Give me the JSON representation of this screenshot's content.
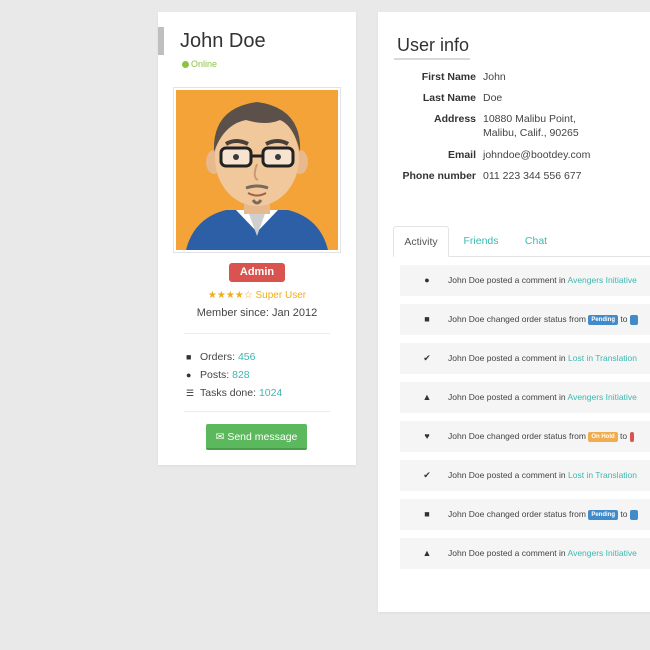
{
  "profile": {
    "name": "John Doe",
    "status": "Online",
    "badge": "Admin",
    "stars": "★★★★☆",
    "rank": "Super User",
    "member_since": "Member since: Jan 2012",
    "stats": [
      {
        "label": "Orders:",
        "value": "456",
        "icon": "truck-icon",
        "glyph": "🚚"
      },
      {
        "label": "Posts:",
        "value": "828",
        "icon": "comment-icon",
        "glyph": "💬"
      },
      {
        "label": "Tasks done:",
        "value": "1024",
        "icon": "tasks-icon",
        "glyph": "☰"
      }
    ],
    "send_button": "Send message",
    "send_icon": "✉"
  },
  "info": {
    "title": "User info",
    "rows": [
      {
        "label": "First Name",
        "value": "John"
      },
      {
        "label": "Last Name",
        "value": "Doe"
      },
      {
        "label": "Address",
        "value": "10880 Malibu Point,",
        "value2": "Malibu, Calif., 90265"
      },
      {
        "label": "Email",
        "value": "johndoe@bootdey.com"
      },
      {
        "label": "Phone number",
        "value": "011 223 344 556 677"
      }
    ]
  },
  "tabs": [
    "Activity",
    "Friends",
    "Chat"
  ],
  "activity": [
    {
      "icon": "comment-icon",
      "glyph": "💬",
      "pre": "John Doe posted a comment in ",
      "link": "Avengers Initiative",
      "kind": "link"
    },
    {
      "icon": "truck-icon",
      "glyph": "🚚",
      "pre": "John Doe changed order status from ",
      "badge": "Pending",
      "badge_class": "st-pending",
      "post": " to ",
      "kind": "status"
    },
    {
      "icon": "check-icon",
      "glyph": "✔",
      "pre": "John Doe posted a comment in ",
      "link": "Lost in Translation",
      "kind": "link"
    },
    {
      "icon": "users-icon",
      "glyph": "👥",
      "pre": "John Doe posted a comment in ",
      "link": "Avengers Initiative",
      "kind": "link"
    },
    {
      "icon": "heart-icon",
      "glyph": "♥",
      "pre": "John Doe changed order status from ",
      "badge": "On Hold",
      "badge_class": "st-hold",
      "post": " to ",
      "kind": "status"
    },
    {
      "icon": "check-icon",
      "glyph": "✔",
      "pre": "John Doe posted a comment in ",
      "link": "Lost in Translation",
      "kind": "link"
    },
    {
      "icon": "truck-icon",
      "glyph": "🚚",
      "pre": "John Doe changed order status from ",
      "badge": "Pending",
      "badge_class": "st-pending",
      "post": " to ",
      "kind": "status"
    },
    {
      "icon": "users-icon",
      "glyph": "👥",
      "pre": "John Doe posted a comment in ",
      "link": "Avengers Initiative",
      "kind": "link"
    }
  ],
  "colors": {
    "accent": "#3cb8b1",
    "online": "#8ac43f",
    "admin": "#d9534f",
    "button": "#5cb85c",
    "star": "#f0ad1a"
  }
}
